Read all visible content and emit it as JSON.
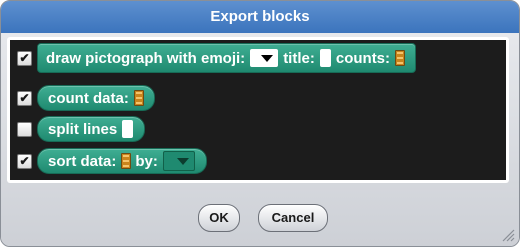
{
  "dialog": {
    "title": "Export blocks",
    "ok_label": "OK",
    "cancel_label": "Cancel"
  },
  "blocks": [
    {
      "checked": true,
      "parts": [
        {
          "kind": "text",
          "value": "draw pictograph with emoji:"
        },
        {
          "kind": "dropdown"
        },
        {
          "kind": "text",
          "value": "title:"
        },
        {
          "kind": "textslot"
        },
        {
          "kind": "text",
          "value": "counts:"
        },
        {
          "kind": "list"
        }
      ]
    },
    {
      "checked": true,
      "parts": [
        {
          "kind": "text",
          "value": "count data:"
        },
        {
          "kind": "list"
        }
      ]
    },
    {
      "checked": false,
      "parts": [
        {
          "kind": "text",
          "value": "split lines"
        },
        {
          "kind": "textslot"
        }
      ]
    },
    {
      "checked": true,
      "parts": [
        {
          "kind": "text",
          "value": "sort data:"
        },
        {
          "kind": "list"
        },
        {
          "kind": "text",
          "value": "by:"
        },
        {
          "kind": "dropdown-green"
        }
      ]
    }
  ],
  "colors": {
    "titlebar": "#3b74bd",
    "block_green": "#1f8a70",
    "canvas": "#1c1c1c"
  }
}
